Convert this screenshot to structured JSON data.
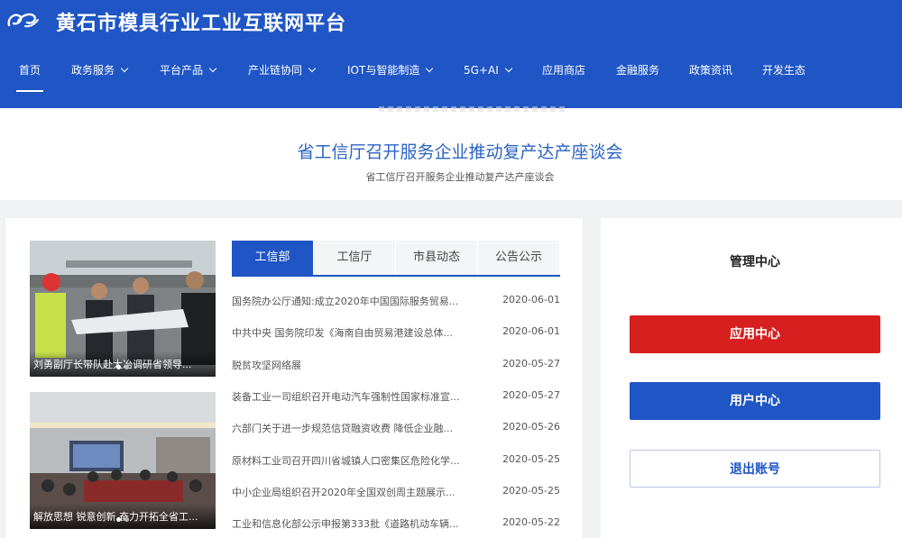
{
  "header": {
    "title": "黄石市模具行业工业互联网平台",
    "nav": [
      {
        "label": "首页",
        "active": true,
        "dropdown": false
      },
      {
        "label": "政务服务",
        "active": false,
        "dropdown": true
      },
      {
        "label": "平台产品",
        "active": false,
        "dropdown": true
      },
      {
        "label": "产业链协同",
        "active": false,
        "dropdown": true
      },
      {
        "label": "IOT与智能制造",
        "active": false,
        "dropdown": true
      },
      {
        "label": "5G+AI",
        "active": false,
        "dropdown": true
      },
      {
        "label": "应用商店",
        "active": false,
        "dropdown": false
      },
      {
        "label": "金融服务",
        "active": false,
        "dropdown": false
      },
      {
        "label": "政策资讯",
        "active": false,
        "dropdown": false
      },
      {
        "label": "开发生态",
        "active": false,
        "dropdown": false
      }
    ]
  },
  "banner": {
    "title": "省工信厅召开服务企业推动复产达产座谈会",
    "subtitle": "省工信厅召开服务企业推动复产达产座谈会"
  },
  "photos": [
    {
      "caption": "刘勇副厅长带队赴大冶调研省领导..."
    },
    {
      "caption": "解放思想 锐意创新 奋力开拓全省工..."
    }
  ],
  "tabs": [
    "工信部",
    "工信厅",
    "市县动态",
    "公告公示"
  ],
  "news": [
    {
      "title": "国务院办公厅通知:成立2020年中国国际服务贸易...",
      "date": "2020-06-01"
    },
    {
      "title": "中共中央 国务院印发《海南自由贸易港建设总体...",
      "date": "2020-06-01"
    },
    {
      "title": "脱贫攻坚网络展",
      "date": "2020-05-27"
    },
    {
      "title": "装备工业一司组织召开电动汽车强制性国家标准宣...",
      "date": "2020-05-27"
    },
    {
      "title": "六部门关于进一步规范信贷融资收费 降低企业融...",
      "date": "2020-05-26"
    },
    {
      "title": "原材料工业司召开四川省城镇人口密集区危险化学...",
      "date": "2020-05-25"
    },
    {
      "title": "中小企业局组织召开2020年全国双创周主题展示...",
      "date": "2020-05-25"
    },
    {
      "title": "工业和信息化部公示申报第333批《道路机动车辆...",
      "date": "2020-05-22"
    }
  ],
  "side": {
    "title": "管理中心",
    "app_center": "应用中心",
    "user_center": "用户中心",
    "logout": "退出账号"
  },
  "colors": {
    "primary": "#1f55c4",
    "danger": "#d71f1f",
    "link": "#2b63c4"
  }
}
